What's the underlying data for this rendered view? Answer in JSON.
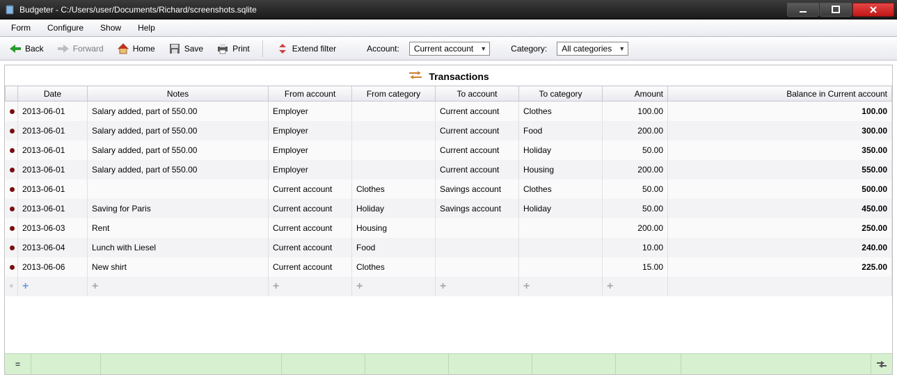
{
  "window": {
    "title": "Budgeter - C:/Users/user/Documents/Richard/screenshots.sqlite"
  },
  "menubar": {
    "items": [
      "Form",
      "Configure",
      "Show",
      "Help"
    ]
  },
  "toolbar": {
    "back": "Back",
    "forward": "Forward",
    "home": "Home",
    "save": "Save",
    "print": "Print",
    "extend_filter": "Extend filter",
    "account_label": "Account:",
    "account_value": "Current account",
    "category_label": "Category:",
    "category_value": "All categories"
  },
  "heading": "Transactions",
  "columns": {
    "date": "Date",
    "notes": "Notes",
    "from_account": "From account",
    "from_category": "From category",
    "to_account": "To account",
    "to_category": "To category",
    "amount": "Amount",
    "balance": "Balance in Current account"
  },
  "rows": [
    {
      "date": "2013-06-01",
      "notes": "Salary added, part of 550.00",
      "from_acc": "Employer",
      "from_cat": "",
      "to_acc": "Current account",
      "to_cat": "Clothes",
      "amount": "100.00",
      "balance": "100.00"
    },
    {
      "date": "2013-06-01",
      "notes": "Salary added, part of 550.00",
      "from_acc": "Employer",
      "from_cat": "",
      "to_acc": "Current account",
      "to_cat": "Food",
      "amount": "200.00",
      "balance": "300.00"
    },
    {
      "date": "2013-06-01",
      "notes": "Salary added, part of 550.00",
      "from_acc": "Employer",
      "from_cat": "",
      "to_acc": "Current account",
      "to_cat": "Holiday",
      "amount": "50.00",
      "balance": "350.00"
    },
    {
      "date": "2013-06-01",
      "notes": "Salary added, part of 550.00",
      "from_acc": "Employer",
      "from_cat": "",
      "to_acc": "Current account",
      "to_cat": "Housing",
      "amount": "200.00",
      "balance": "550.00"
    },
    {
      "date": "2013-06-01",
      "notes": "",
      "from_acc": "Current account",
      "from_cat": "Clothes",
      "to_acc": "Savings account",
      "to_cat": "Clothes",
      "amount": "50.00",
      "balance": "500.00"
    },
    {
      "date": "2013-06-01",
      "notes": "Saving for Paris",
      "from_acc": "Current account",
      "from_cat": "Holiday",
      "to_acc": "Savings account",
      "to_cat": "Holiday",
      "amount": "50.00",
      "balance": "450.00"
    },
    {
      "date": "2013-06-03",
      "notes": "Rent",
      "from_acc": "Current account",
      "from_cat": "Housing",
      "to_acc": "",
      "to_cat": "",
      "amount": "200.00",
      "balance": "250.00"
    },
    {
      "date": "2013-06-04",
      "notes": "Lunch with Liesel",
      "from_acc": "Current account",
      "from_cat": "Food",
      "to_acc": "",
      "to_cat": "",
      "amount": "10.00",
      "balance": "240.00"
    },
    {
      "date": "2013-06-06",
      "notes": "New shirt",
      "from_acc": "Current account",
      "from_cat": "Clothes",
      "to_acc": "",
      "to_cat": "",
      "amount": "15.00",
      "balance": "225.00"
    }
  ],
  "footer": {
    "eq": "="
  }
}
